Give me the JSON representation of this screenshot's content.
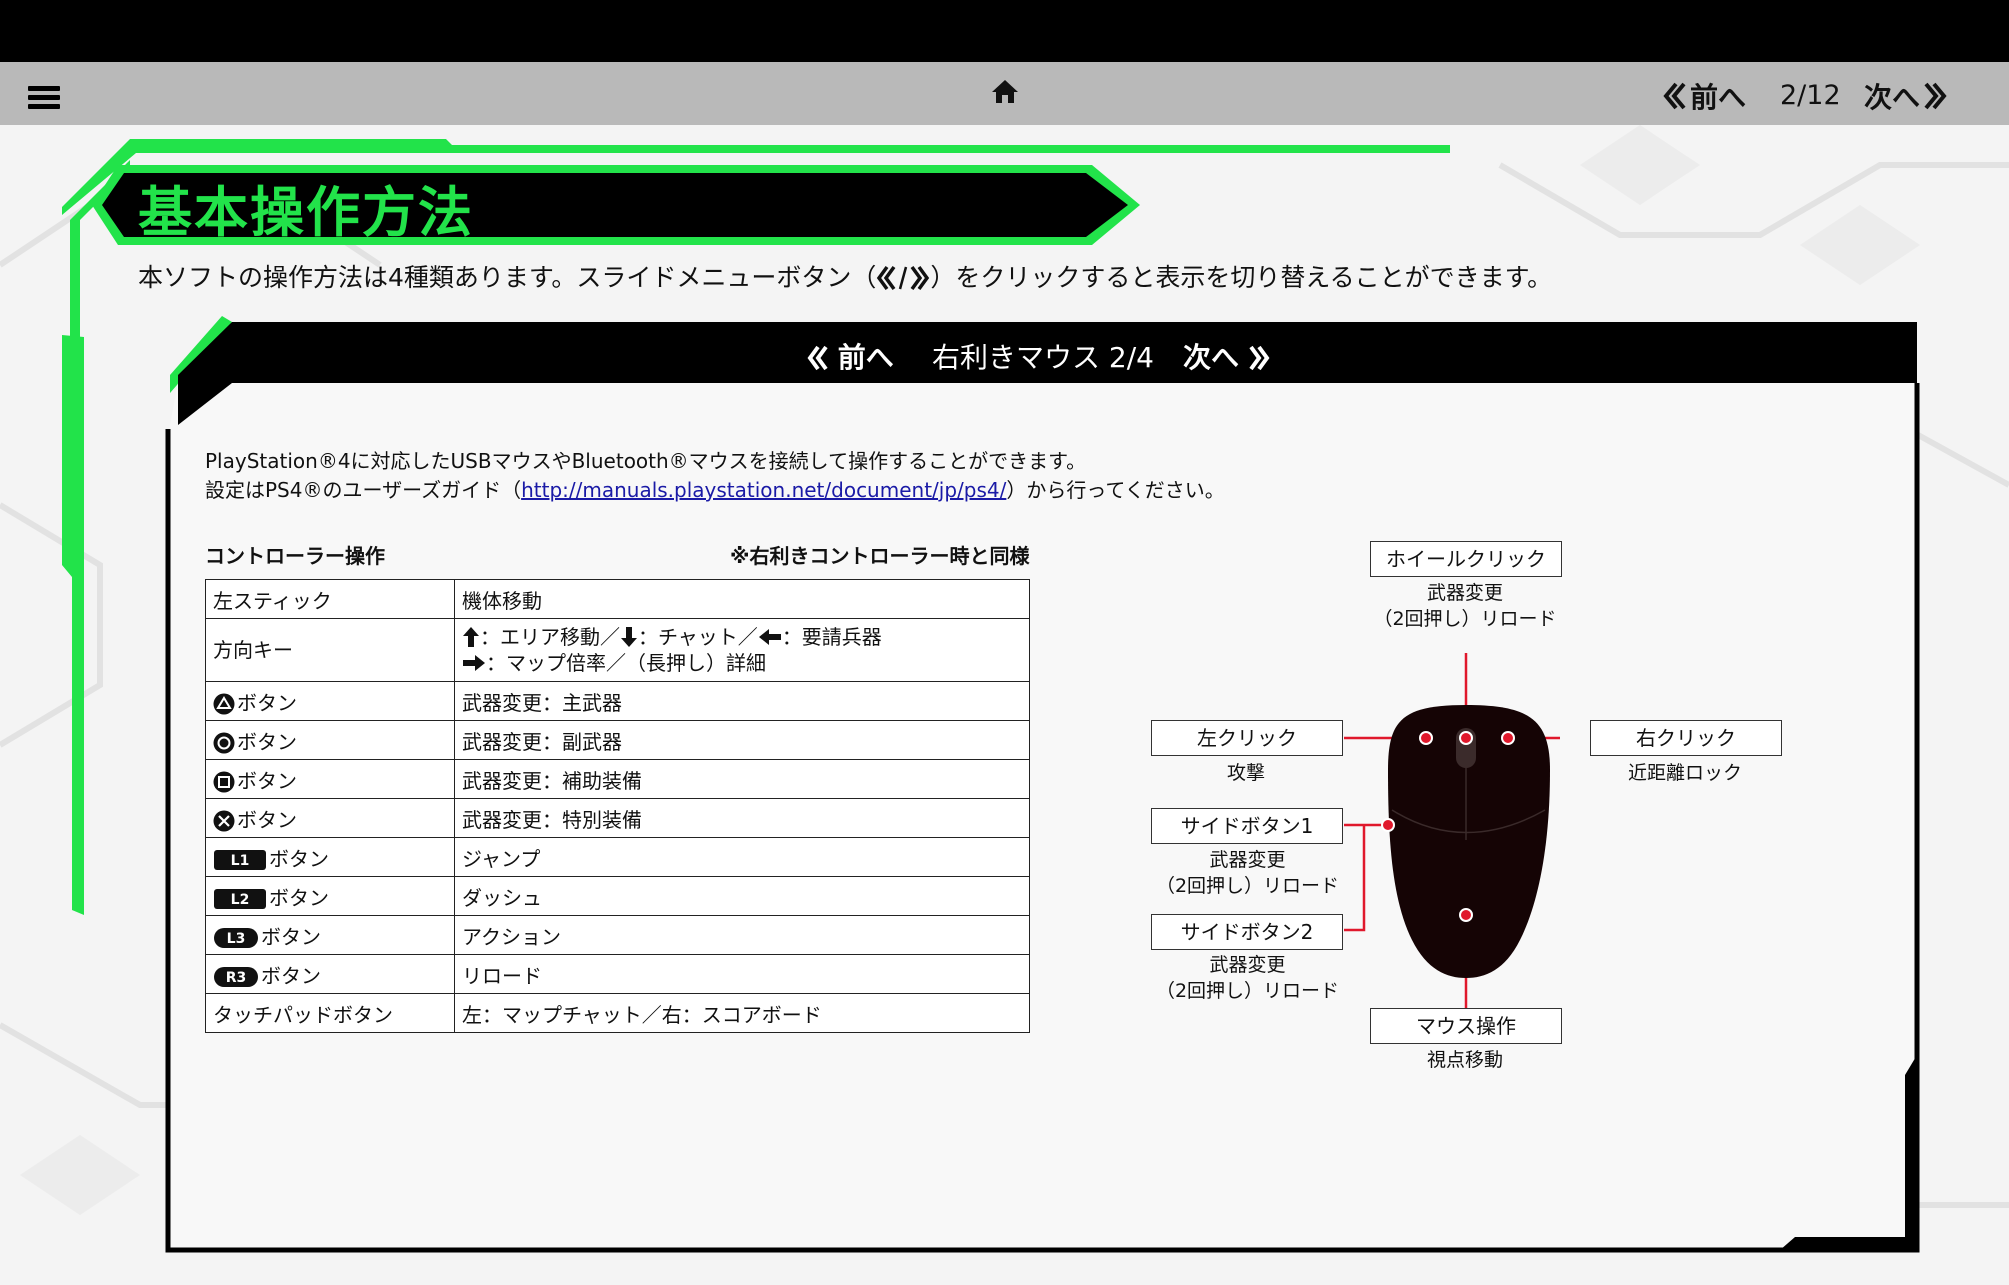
{
  "nav": {
    "prev_label": "前へ",
    "page_indicator": "2/12",
    "next_label": "次へ"
  },
  "header": {
    "title": "基本操作方法",
    "intro_before": "本ソフトの操作方法は4種類あります。スライドメニューボタン（",
    "intro_after": "）をクリックすると表示を切り替えることができます。"
  },
  "panel": {
    "prev_label": "前へ",
    "title": "右利きマウス 2/4",
    "next_label": "次へ",
    "desc_line1": "PlayStation®4に対応したUSBマウスやBluetooth®マウスを接続して操作することができます。",
    "desc_line2_before": "設定はPS4®のユーザーズガイド（",
    "desc_link": "http://manuals.playstation.net/document/jp/ps4/",
    "desc_line2_after": "）から行ってください。"
  },
  "controller": {
    "caption": "コントローラー操作",
    "note": "※右利きコントローラー時と同様",
    "rows": [
      {
        "key": "左スティック",
        "value": "機体移動"
      },
      {
        "key": "方向キー",
        "value_line1": "：エリア移動／",
        "value_line1b": "：チャット／",
        "value_line1c": "：要請兵器",
        "value_line2": "：マップ倍率／（長押し）詳細"
      },
      {
        "key": "ボタン",
        "value": "武器変更：主武器"
      },
      {
        "key": "ボタン",
        "value": "武器変更：副武器"
      },
      {
        "key": "ボタン",
        "value": "武器変更：補助装備"
      },
      {
        "key": "ボタン",
        "value": "武器変更：特別装備"
      },
      {
        "key": "ボタン",
        "badge": "L1",
        "value": "ジャンプ"
      },
      {
        "key": "ボタン",
        "badge": "L2",
        "value": "ダッシュ"
      },
      {
        "key": "ボタン",
        "badge": "L3",
        "value": "アクション"
      },
      {
        "key": "ボタン",
        "badge": "R3",
        "value": "リロード"
      },
      {
        "key": "タッチパッドボタン",
        "value": "左：マップチャット／右：スコアボード"
      }
    ]
  },
  "mouse": {
    "wheel_click": {
      "label": "ホイールクリック",
      "line1": "武器変更",
      "line2": "（2回押し）リロード"
    },
    "left_click": {
      "label": "左クリック",
      "line1": "攻撃"
    },
    "right_click": {
      "label": "右クリック",
      "line1": "近距離ロック"
    },
    "side1": {
      "label": "サイドボタン1",
      "line1": "武器変更",
      "line2": "（2回押し）リロード"
    },
    "side2": {
      "label": "サイドボタン2",
      "line1": "武器変更",
      "line2": "（2回押し）リロード"
    },
    "move": {
      "label": "マウス操作",
      "line1": "視点移動"
    }
  },
  "colors": {
    "accent_green": "#22e34a",
    "marker_red": "#e0182c",
    "link_blue": "#1a1aa6"
  }
}
